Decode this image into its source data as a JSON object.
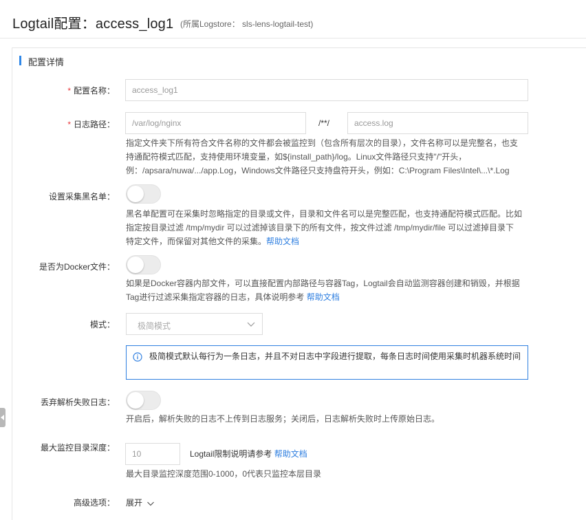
{
  "header": {
    "title": "Logtail配置：access_log1",
    "subtitle": "(所属Logstore： sls-lens-logtail-test)"
  },
  "section": {
    "title": "配置详情"
  },
  "fields": {
    "config_name": {
      "label": "配置名称：",
      "required": "*",
      "value": "access_log1"
    },
    "log_path": {
      "label": "日志路径：",
      "required": "*",
      "dir_value": "/var/log/nginx",
      "separator": "/**/",
      "file_value": "access.log",
      "help_line1": "指定文件夹下所有符合文件名称的文件都会被监控到（包含所有层次的目录），文件名称可以是完整名，也支",
      "help_line2": "持通配符模式匹配，支持使用环境变量，如${install_path}/log。Linux文件路径只支持\"/\"开头，",
      "help_line3": "例：/apsara/nuwa/.../app.Log，Windows文件路径只支持盘符开头，例如：C:\\Program Files\\Intel\\...\\*.Log"
    },
    "blacklist": {
      "label": "设置采集黑名单：",
      "help_line1": "黑名单配置可在采集时忽略指定的目录或文件，目录和文件名可以是完整匹配，也支持通配符模式匹配。比如",
      "help_line2": "指定按目录过滤 /tmp/mydir 可以过滤掉该目录下的所有文件，按文件过滤 /tmp/mydir/file 可以过滤掉目录下",
      "help_line3": "特定文件，而保留对其他文件的采集。",
      "help_link": "帮助文档"
    },
    "docker": {
      "label": "是否为Docker文件：",
      "help_line1": "如果是Docker容器内部文件，可以直接配置内部路径与容器Tag，Logtail会自动监测容器创建和销毁，并根据",
      "help_line2": "Tag进行过滤采集指定容器的日志，具体说明参考 ",
      "help_link": "帮助文档"
    },
    "mode": {
      "label": "模式：",
      "selected": "极简模式",
      "info": "极简模式默认每行为一条日志，并且不对日志中字段进行提取，每条日志时间使用采集时机器系统时间"
    },
    "discard": {
      "label": "丢弃解析失败日志：",
      "help": "开启后，解析失败的日志不上传到日志服务；关闭后，日志解析失败时上传原始日志。"
    },
    "max_depth": {
      "label": "最大监控目录深度：",
      "value": "10",
      "note": "Logtail限制说明请参考 ",
      "note_link": "帮助文档",
      "help": "最大目录监控深度范围0-1000，0代表只监控本层目录"
    },
    "advanced": {
      "label": "高级选项：",
      "toggle_text": "展开"
    }
  },
  "colors": {
    "accent": "#2f87e8",
    "required": "#e8363a",
    "link": "#2f7fe0"
  },
  "icons": {
    "info": "info-icon",
    "select_chevron": "chevron-down-icon",
    "expand_chevron": "chevron-down-icon",
    "side_handle": "caret-left-icon"
  }
}
